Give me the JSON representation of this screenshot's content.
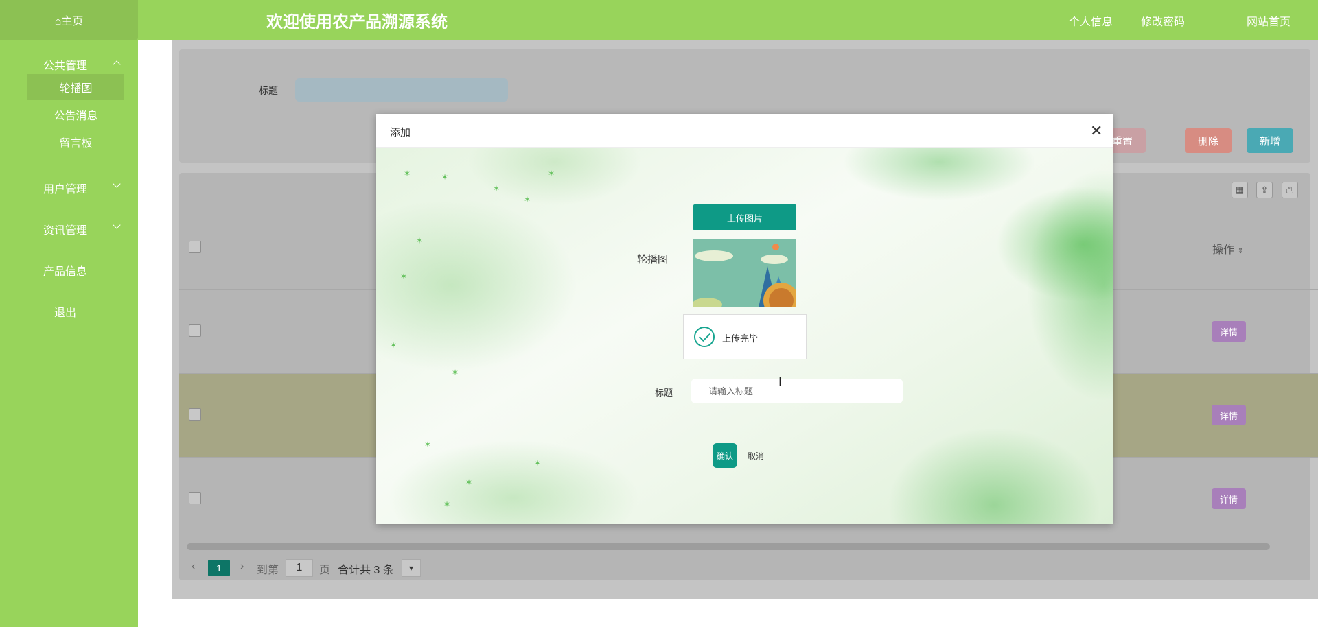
{
  "header": {
    "home": "⌂主页",
    "title": "欢迎使用农产品溯源系统",
    "links": [
      "个人信息",
      "修改密码",
      "网站首页"
    ]
  },
  "sidebar": {
    "groups": [
      {
        "label": "公共管理",
        "items": [
          "轮播图",
          "公告消息",
          "留言板"
        ]
      },
      {
        "label": "用户管理"
      },
      {
        "label": "资讯管理"
      },
      {
        "label": "产品信息"
      },
      {
        "label": "退出"
      }
    ]
  },
  "search": {
    "title_label": "标题"
  },
  "toolbar": {
    "reset": "重置",
    "delete": "删除",
    "add": "新增"
  },
  "table": {
    "op_header": "操作",
    "detail_label": "详情"
  },
  "pagination": {
    "current_page": "1",
    "goto": "到第",
    "goto_value": "1",
    "page_unit": "页",
    "total": "合计共 3 条"
  },
  "modal": {
    "title": "添加",
    "close": "✕",
    "upload_button": "上传图片",
    "banner_label": "轮播图",
    "toast": "上传完毕",
    "title_label": "标题",
    "title_placeholder": "请输入标题",
    "confirm": "确认",
    "cancel": "取消"
  },
  "colors": {
    "sidebar": "#98d45b",
    "primary": "#0e9a86",
    "reset": "#c9a0a4",
    "delete": "#d78c82",
    "add": "#4aa9b4",
    "detail": "#a87fba"
  }
}
